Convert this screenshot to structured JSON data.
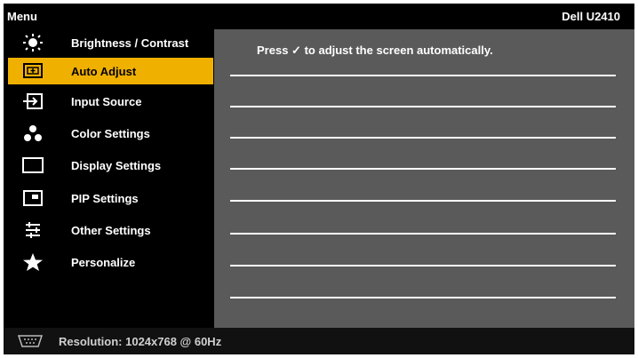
{
  "title": {
    "menu": "Menu",
    "model": "Dell U2410"
  },
  "menu": {
    "items": [
      {
        "label": "Brightness / Contrast",
        "icon": "brightness-icon"
      },
      {
        "label": "Auto Adjust",
        "icon": "auto-adjust-icon",
        "selected": true
      },
      {
        "label": "Input Source",
        "icon": "input-source-icon"
      },
      {
        "label": "Color Settings",
        "icon": "color-settings-icon"
      },
      {
        "label": "Display Settings",
        "icon": "display-settings-icon"
      },
      {
        "label": "PIP Settings",
        "icon": "pip-settings-icon"
      },
      {
        "label": "Other Settings",
        "icon": "other-settings-icon"
      },
      {
        "label": "Personalize",
        "icon": "personalize-icon"
      }
    ]
  },
  "panel": {
    "message_before": "Press",
    "check_glyph": "✓",
    "message_after": "to adjust the screen automatically."
  },
  "footer": {
    "resolution": "Resolution: 1024x768 @ 60Hz",
    "icon": "vga-connector-icon"
  },
  "colors": {
    "selected_bg": "#f0b000",
    "panel_bg": "#5a5a5a",
    "background": "#000000",
    "text": "#ffffff"
  }
}
